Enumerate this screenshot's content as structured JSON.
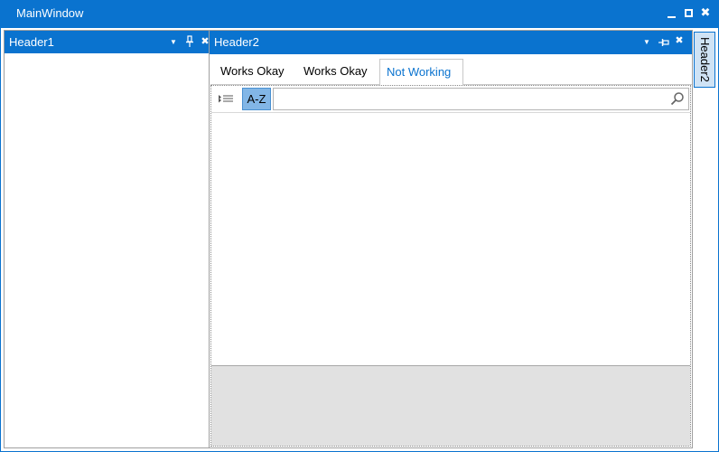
{
  "window": {
    "title": "MainWindow",
    "accent_color": "#0a73cf",
    "buttons": {
      "minimize_icon": "minimize-icon",
      "maximize_icon": "maximize-icon",
      "close_icon": "close-icon"
    }
  },
  "panel1": {
    "header": "Header1",
    "icons": [
      "dropdown-icon",
      "pin-icon",
      "close-icon"
    ]
  },
  "panel2": {
    "header": "Header2",
    "icons": [
      "dropdown-icon",
      "unpin-icon",
      "close-icon"
    ],
    "tabs": [
      {
        "label": "Works Okay",
        "selected": false
      },
      {
        "label": "Works Okay",
        "selected": false
      },
      {
        "label": "Not Working",
        "selected": true
      }
    ],
    "property_grid": {
      "categorized_icon": "categorized-list-icon",
      "sort_button_label": "A-Z",
      "search": {
        "value": "",
        "placeholder": ""
      },
      "search_icon": "search-icon"
    }
  },
  "side_tab": {
    "label": "Header2"
  }
}
